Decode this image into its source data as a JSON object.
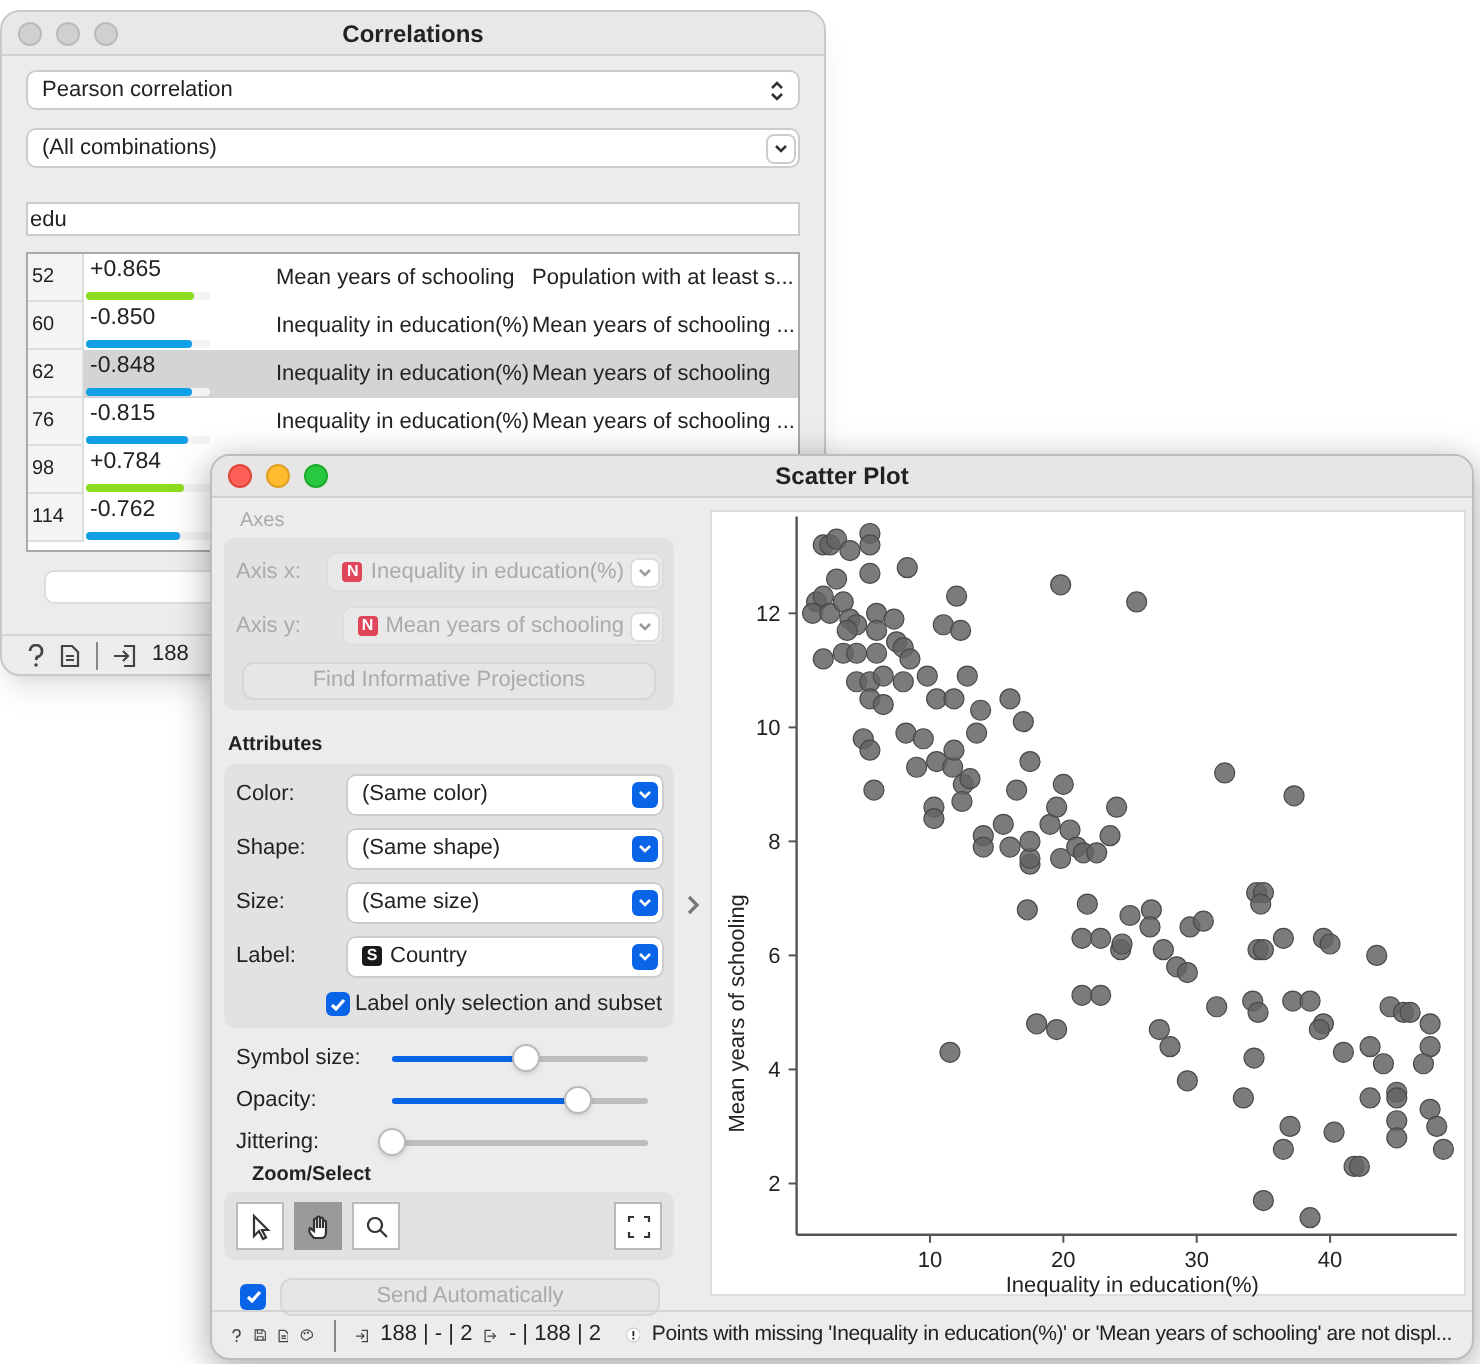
{
  "correlations_window": {
    "title": "Correlations",
    "method": "Pearson correlation",
    "feature": "(All combinations)",
    "filter": "edu",
    "rows": [
      {
        "index": "52",
        "value": "+0.865",
        "level": 0.865,
        "color": "#8ddc1e",
        "attribute_1": "Mean years of schooling",
        "attribute_2": "Population with at least s...",
        "selected": false
      },
      {
        "index": "60",
        "value": "-0.850",
        "level": 0.85,
        "color": "#0fa0e6",
        "attribute_1": "Inequality in education(%)",
        "attribute_2": "Mean years of schooling ...",
        "selected": false
      },
      {
        "index": "62",
        "value": "-0.848",
        "level": 0.848,
        "color": "#0fa0e6",
        "attribute_1": "Inequality in education(%)",
        "attribute_2": "Mean years of schooling",
        "selected": true
      },
      {
        "index": "76",
        "value": "-0.815",
        "level": 0.815,
        "color": "#0fa0e6",
        "attribute_1": "Inequality in education(%)",
        "attribute_2": "Mean years of schooling ...",
        "selected": false
      },
      {
        "index": "98",
        "value": "+0.784",
        "level": 0.784,
        "color": "#8ddc1e",
        "selected": false
      },
      {
        "index": "114",
        "value": "-0.762",
        "level": 0.762,
        "color": "#0fa0e6",
        "selected": false
      }
    ],
    "status_bar": {
      "input_count": "188"
    }
  },
  "scatter_window": {
    "title": "Scatter Plot",
    "axes": {
      "title": "Axes",
      "disabled": true,
      "fields": [
        {
          "label": "Axis x:",
          "badge": "N",
          "color": "#e0455a",
          "value": "Inequality in education(%)"
        },
        {
          "label": "Axis y:",
          "badge": "N",
          "color": "#e0455a",
          "value": "Mean years of schooling"
        }
      ],
      "find_button": "Find Informative Projections"
    },
    "attributes": {
      "title": "Attributes",
      "fields": [
        {
          "label": "Color:",
          "value": "(Same color)"
        },
        {
          "label": "Shape:",
          "value": "(Same shape)"
        },
        {
          "label": "Size:",
          "value": "(Same size)"
        },
        {
          "label": "Label:",
          "badge": "S",
          "color": "#1a1a1a",
          "value": "Country"
        }
      ],
      "label_only": {
        "label": "Label only selection and subset",
        "checked": true
      }
    },
    "sliders": [
      {
        "label": "Symbol size:",
        "level": 0.52
      },
      {
        "label": "Opacity:",
        "level": 0.73
      },
      {
        "label": "Jittering:",
        "level": 0
      }
    ],
    "zoom_select": {
      "title": "Zoom/Select",
      "tools": [
        {
          "kind": "pointer",
          "selected": false
        },
        {
          "kind": "pan",
          "selected": true
        },
        {
          "kind": "zoom",
          "selected": false
        },
        {
          "kind": "fit",
          "selected": false
        }
      ]
    },
    "send": {
      "checked": true,
      "label": "Send Automatically",
      "disabled": true
    },
    "plot": {
      "chart_data": {
        "type": "scatter",
        "xlabel": "Inequality in education(%)",
        "ylabel": "Mean years of schooling",
        "xlim": [
          0,
          49.5
        ],
        "ylim": [
          1.1,
          13.7
        ],
        "xticks": [
          10,
          20,
          30,
          40
        ],
        "yticks": [
          2,
          4,
          6,
          8,
          10,
          12
        ],
        "x": [
          1.5,
          2,
          2.5,
          3,
          4,
          5.5,
          5.5,
          5.5,
          8.3,
          1.2,
          2,
          2.5,
          3,
          3.5,
          4,
          4.5,
          3.8,
          2,
          3.5,
          4.5,
          6,
          6,
          6,
          7.3,
          7.5,
          8,
          8.5,
          4.5,
          5.5,
          6.5,
          5.5,
          6.5,
          8,
          11,
          12,
          12.3,
          9.8,
          10.5,
          11.8,
          12.8,
          13.8,
          13.5,
          8.2,
          9.5,
          5,
          5.5,
          5.8,
          9,
          10.5,
          11.7,
          11.8,
          12.5,
          13,
          12.4,
          10.3,
          10.3,
          14,
          14,
          15.5,
          16,
          16.5,
          16,
          17,
          17.5,
          17.5,
          17.5,
          17.5,
          19,
          19.5,
          20,
          19.8,
          20.5,
          21,
          21.5,
          22.5,
          23.5,
          24,
          19.8,
          25.5,
          17.3,
          21.8,
          21.4,
          22.8,
          24.3,
          24.4,
          25,
          26.6,
          26.5,
          27.5,
          28.5,
          29.3,
          29.5,
          30.5,
          21.4,
          22.8,
          18,
          19.5,
          11.5,
          27.2,
          28,
          29.3,
          31.5,
          32.1,
          37.3,
          34.5,
          35,
          34.8,
          34.6,
          35,
          36.5,
          39.5,
          40,
          43.5,
          34.2,
          34.6,
          37.2,
          38.5,
          39.5,
          39.2,
          41,
          34.3,
          33.5,
          43,
          44,
          44.5,
          45.5,
          46,
          47.5,
          47.5,
          47,
          45,
          45,
          43,
          45,
          45,
          47.5,
          48,
          48.5,
          37,
          36.5,
          40.3,
          41.8,
          42.2,
          35,
          38.5
        ],
        "values": [
          12.2,
          13.2,
          13.2,
          13.3,
          13.1,
          13.4,
          13.2,
          12.7,
          12.8,
          12,
          12.3,
          12,
          12.6,
          12.2,
          11.9,
          11.8,
          11.7,
          11.2,
          11.3,
          11.3,
          12,
          11.7,
          11.3,
          11.9,
          11.5,
          11.4,
          11.2,
          10.8,
          10.8,
          10.9,
          10.5,
          10.4,
          10.8,
          11.8,
          12.3,
          11.7,
          10.9,
          10.5,
          10.5,
          10.9,
          10.3,
          9.9,
          9.9,
          9.8,
          9.8,
          9.6,
          8.9,
          9.3,
          9.4,
          9.3,
          9.6,
          9,
          9.1,
          8.7,
          8.6,
          8.4,
          8.1,
          7.9,
          8.3,
          7.9,
          8.9,
          10.5,
          10.1,
          9.4,
          7.6,
          7.7,
          8,
          8.3,
          8.6,
          9,
          7.7,
          8.2,
          7.9,
          7.8,
          7.8,
          8.1,
          8.6,
          12.5,
          12.2,
          6.8,
          6.9,
          6.3,
          6.3,
          6.1,
          6.2,
          6.7,
          6.8,
          6.5,
          6.1,
          5.8,
          5.7,
          6.5,
          6.6,
          5.3,
          5.3,
          4.8,
          4.7,
          4.3,
          4.7,
          4.4,
          3.8,
          5.1,
          9.2,
          8.8,
          7.1,
          7.1,
          6.9,
          6.1,
          6.1,
          6.3,
          6.3,
          6.2,
          6,
          5.2,
          5,
          5.2,
          5.2,
          4.8,
          4.7,
          4.3,
          4.2,
          3.5,
          4.4,
          4.1,
          5.1,
          5,
          5,
          4.8,
          4.4,
          4.1,
          3.6,
          3.5,
          3.5,
          3.1,
          2.8,
          3.3,
          3,
          2.6,
          3,
          2.6,
          2.9,
          2.3,
          2.3,
          1.7,
          1.4
        ]
      }
    },
    "status_bar": {
      "input": "188 | - | 2",
      "output": "- | 188 | 2",
      "warning": "Points with missing 'Inequality in education(%)' or 'Mean years of schooling' are not displ..."
    }
  }
}
